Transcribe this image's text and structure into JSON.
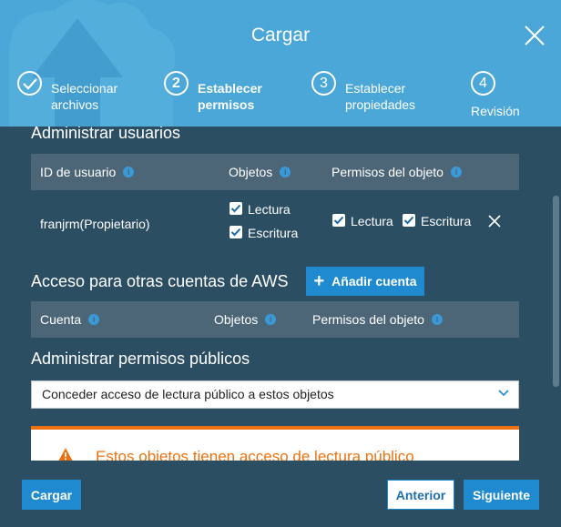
{
  "dialog": {
    "title": "Cargar"
  },
  "steps": [
    {
      "number": "",
      "label": "Seleccionar archivos",
      "state": "done"
    },
    {
      "number": "2",
      "label": "Establecer permisos",
      "state": "active"
    },
    {
      "number": "3",
      "label": "Establecer propiedades",
      "state": "pending"
    },
    {
      "number": "4",
      "label": "Revisión",
      "state": "pending"
    }
  ],
  "manage_users": {
    "title": "Administrar usuarios",
    "columns": [
      "ID de usuario",
      "Objetos",
      "Permisos del objeto"
    ],
    "rows": [
      {
        "user_id": "franjrm(Propietario)",
        "objects": [
          {
            "label": "Lectura",
            "checked": true
          },
          {
            "label": "Escritura",
            "checked": true
          }
        ],
        "object_permissions": [
          {
            "label": "Lectura",
            "checked": true
          },
          {
            "label": "Escritura",
            "checked": true
          }
        ]
      }
    ]
  },
  "other_accounts": {
    "title": "Acceso para otras cuentas de AWS",
    "add_button": "Añadir cuenta",
    "columns": [
      "Cuenta",
      "Objetos",
      "Permisos del objeto"
    ]
  },
  "public_permissions": {
    "title": "Administrar permisos públicos",
    "selected": "Conceder acceso de lectura público a estos objetos"
  },
  "warning": {
    "text": "Estos objetos tienen acceso de lectura público"
  },
  "footer": {
    "upload": "Cargar",
    "previous": "Anterior",
    "next": "Siguiente"
  },
  "colors": {
    "header": "#4aa7d8",
    "body": "#2b4e63",
    "table_header": "#4c6677",
    "primary": "#1f8ad0",
    "warning": "#ec7211"
  }
}
